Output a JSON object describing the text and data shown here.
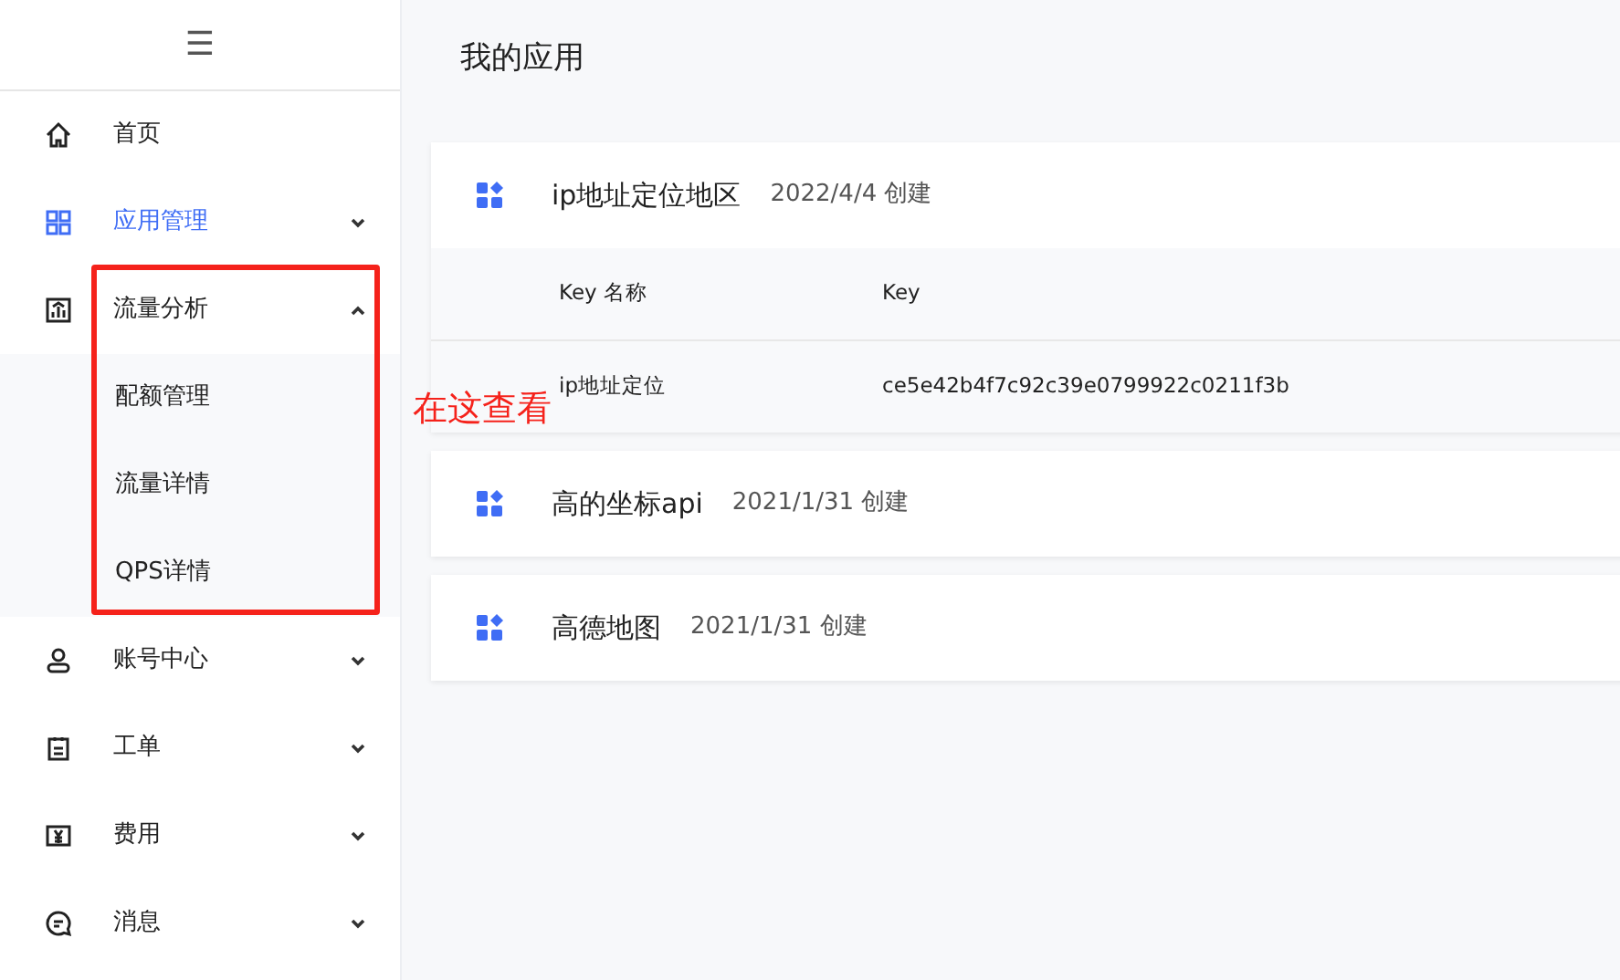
{
  "sidebar": {
    "toggle": "☰",
    "items": [
      {
        "label": "首页",
        "kind": "link",
        "selected": false
      },
      {
        "label": "应用管理",
        "kind": "group",
        "selected": true,
        "expanded": false
      },
      {
        "label": "流量分析",
        "kind": "group",
        "selected": false,
        "expanded": true,
        "highlighted": true,
        "children": [
          {
            "label": "配额管理"
          },
          {
            "label": "流量详情"
          },
          {
            "label": "QPS详情"
          }
        ]
      },
      {
        "label": "账号中心",
        "kind": "group",
        "selected": false,
        "expanded": false
      },
      {
        "label": "工单",
        "kind": "group",
        "selected": false,
        "expanded": false
      },
      {
        "label": "费用",
        "kind": "group",
        "selected": false,
        "expanded": false
      },
      {
        "label": "消息",
        "kind": "group",
        "selected": false,
        "expanded": false
      }
    ]
  },
  "annotation": {
    "text": "在这查看"
  },
  "page_title": "我的应用",
  "apps": [
    {
      "name": "ip地址定位地区",
      "created": "2022/4/4 创建",
      "keys": {
        "columns": [
          "Key 名称",
          "Key"
        ],
        "rows": [
          [
            "ip地址定位",
            "ce5e42b4f7c92c39e0799922c0211f3b"
          ]
        ]
      }
    },
    {
      "name": "高的坐标api",
      "created": "2021/1/31 创建"
    },
    {
      "name": "高德地图",
      "created": "2021/1/31 创建"
    }
  ]
}
